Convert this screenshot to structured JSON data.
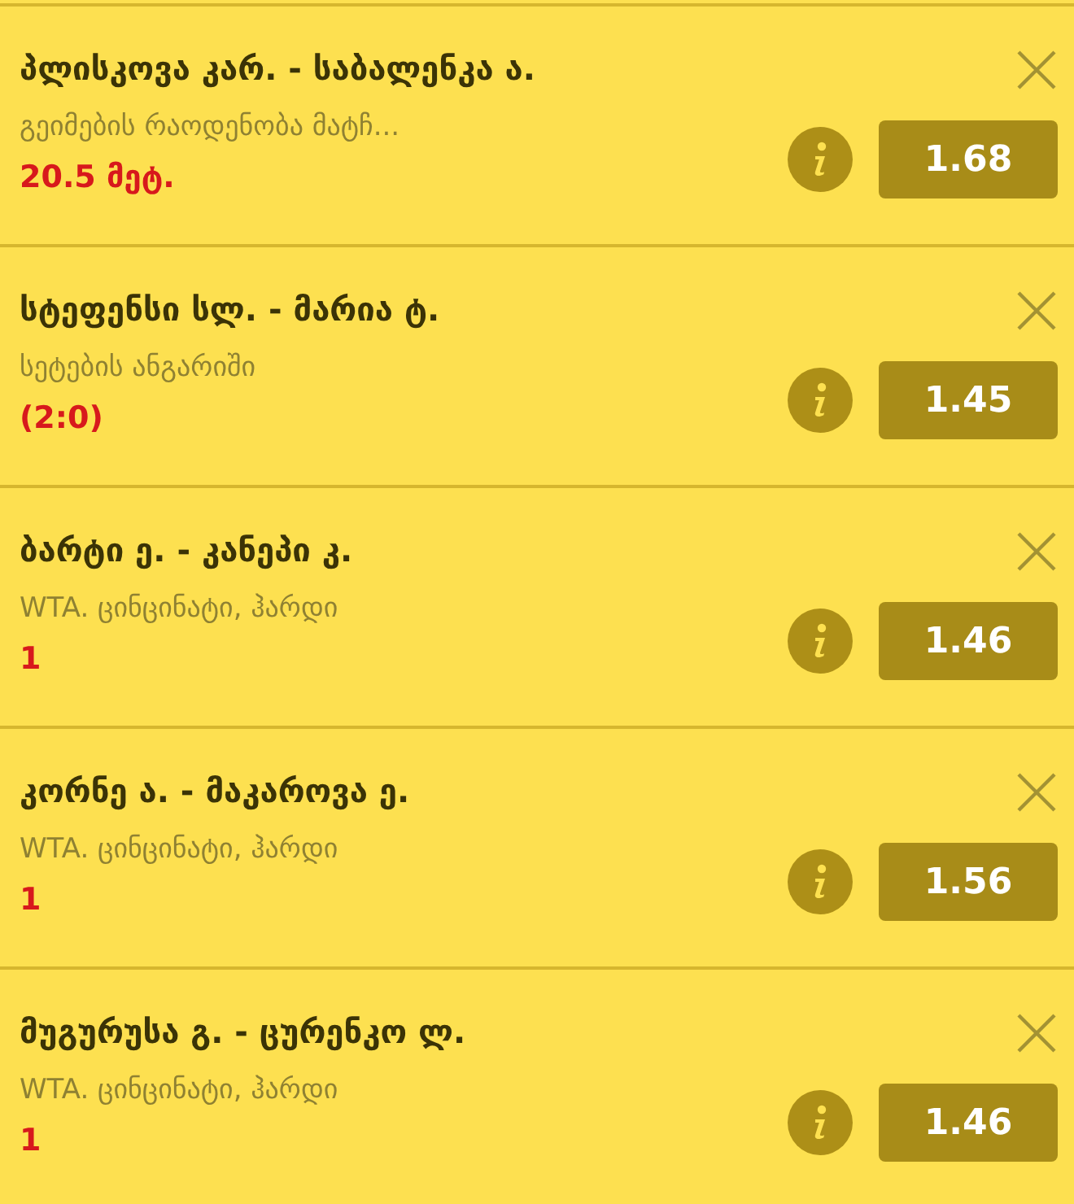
{
  "bets": [
    {
      "match": "პლისკოვა კარ. - საბალენკა ა.",
      "market": "გეიმების რაოდენობა მატჩ...",
      "pick": "20.5 მეტ.",
      "odds": "1.68"
    },
    {
      "match": "სტეფენსი სლ. - მარია ტ.",
      "market": "სეტების ანგარიში",
      "pick": "(2:0)",
      "odds": "1.45"
    },
    {
      "match": "ბარტი ე. - კანეპი კ.",
      "market": "WTA. ცინცინატი, ჰარდი",
      "pick": "1",
      "odds": "1.46"
    },
    {
      "match": "კორნე ა. - მაკაროვა ე.",
      "market": "WTA. ცინცინატი, ჰარდი",
      "pick": "1",
      "odds": "1.56"
    },
    {
      "match": "მუგურუსა გ. - ცურენკო ლ.",
      "market": "WTA. ცინცინატი, ჰარდი",
      "pick": "1",
      "odds": "1.46"
    }
  ]
}
